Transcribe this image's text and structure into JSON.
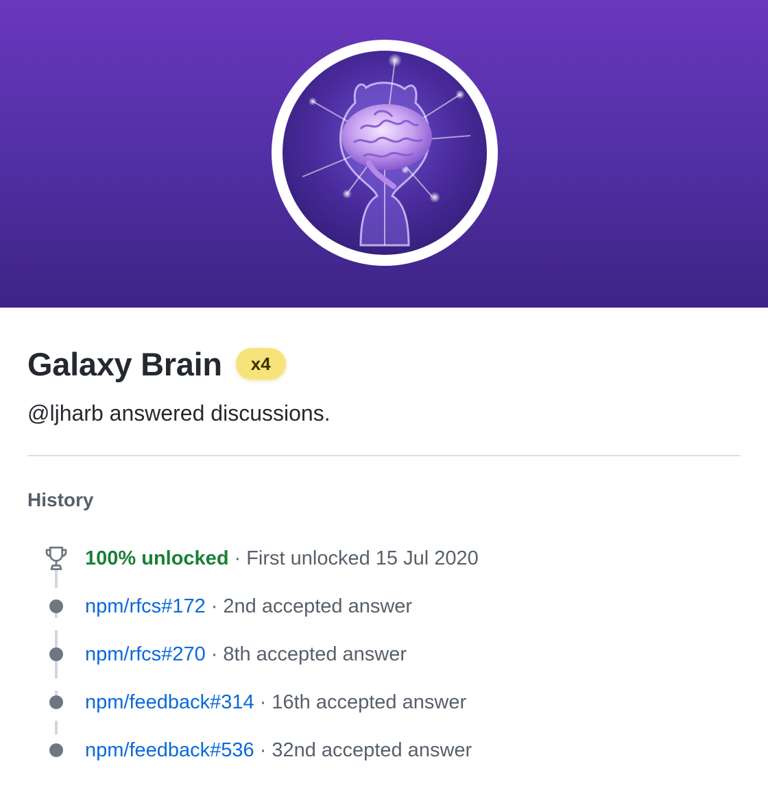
{
  "badge": {
    "title": "Galaxy Brain",
    "tier": "x4",
    "description": "@ljharb answered discussions.",
    "image_icon": "galaxy-brain-achievement-icon"
  },
  "history": {
    "heading": "History",
    "unlocked": {
      "status": "100% unlocked",
      "separator": "·",
      "detail": "First unlocked 15 Jul 2020"
    },
    "entries": [
      {
        "link": "npm/rfcs#172",
        "separator": "·",
        "detail": "2nd accepted answer"
      },
      {
        "link": "npm/rfcs#270",
        "separator": "·",
        "detail": "8th accepted answer"
      },
      {
        "link": "npm/feedback#314",
        "separator": "·",
        "detail": "16th accepted answer"
      },
      {
        "link": "npm/feedback#536",
        "separator": "·",
        "detail": "32nd accepted answer"
      }
    ]
  },
  "colors": {
    "banner_top": "#6a37bd",
    "banner_bottom": "#3e2386",
    "tier_pill": "#f8e37a",
    "unlocked_green": "#1a7f37",
    "link_blue": "#0969da"
  }
}
